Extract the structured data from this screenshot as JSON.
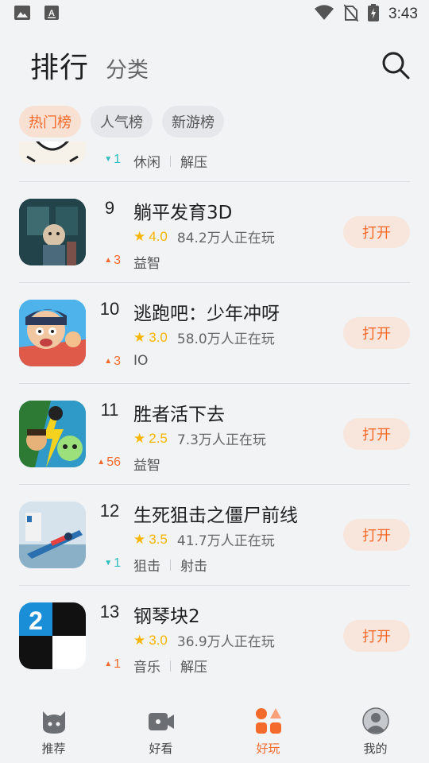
{
  "status_bar": {
    "time": "3:43"
  },
  "header": {
    "title": "排行",
    "subtitle": "分类"
  },
  "tabs": [
    {
      "label": "热门榜",
      "active": true
    },
    {
      "label": "人气榜",
      "active": false
    },
    {
      "label": "新游榜",
      "active": false
    }
  ],
  "partial_item": {
    "trend": "1",
    "trend_dir": "down",
    "tags": [
      "休闲",
      "解压"
    ]
  },
  "items": [
    {
      "rank": "9",
      "name": "躺平发育3D",
      "rating": "4.0",
      "players": "84.2万人正在玩",
      "trend": "3",
      "trend_dir": "up",
      "tags": [
        "益智"
      ],
      "button": "打开"
    },
    {
      "rank": "10",
      "name": "逃跑吧：少年冲呀",
      "rating": "3.0",
      "players": "58.0万人正在玩",
      "trend": "3",
      "trend_dir": "up",
      "tags": [
        "IO"
      ],
      "button": "打开"
    },
    {
      "rank": "11",
      "name": "胜者活下去",
      "rating": "2.5",
      "players": "7.3万人正在玩",
      "trend": "56",
      "trend_dir": "up",
      "tags": [
        "益智"
      ],
      "button": "打开"
    },
    {
      "rank": "12",
      "name": "生死狙击之僵尸前线",
      "rating": "3.5",
      "players": "41.7万人正在玩",
      "trend": "1",
      "trend_dir": "down",
      "tags": [
        "狙击",
        "射击"
      ],
      "button": "打开"
    },
    {
      "rank": "13",
      "name": "钢琴块2",
      "rating": "3.0",
      "players": "36.9万人正在玩",
      "trend": "1",
      "trend_dir": "up",
      "tags": [
        "音乐",
        "解压"
      ],
      "button": "打开"
    }
  ],
  "bottom_nav": [
    {
      "label": "推荐",
      "icon": "recommend-icon",
      "active": false
    },
    {
      "label": "好看",
      "icon": "video-icon",
      "active": false
    },
    {
      "label": "好玩",
      "icon": "games-icon",
      "active": true
    },
    {
      "label": "我的",
      "icon": "profile-icon",
      "active": false
    }
  ],
  "colors": {
    "accent": "#f36a2a",
    "accent_bg": "#f8e6dc",
    "star": "#f7b500",
    "trend_down": "#2dbdbd",
    "background": "#f1f3f5"
  }
}
